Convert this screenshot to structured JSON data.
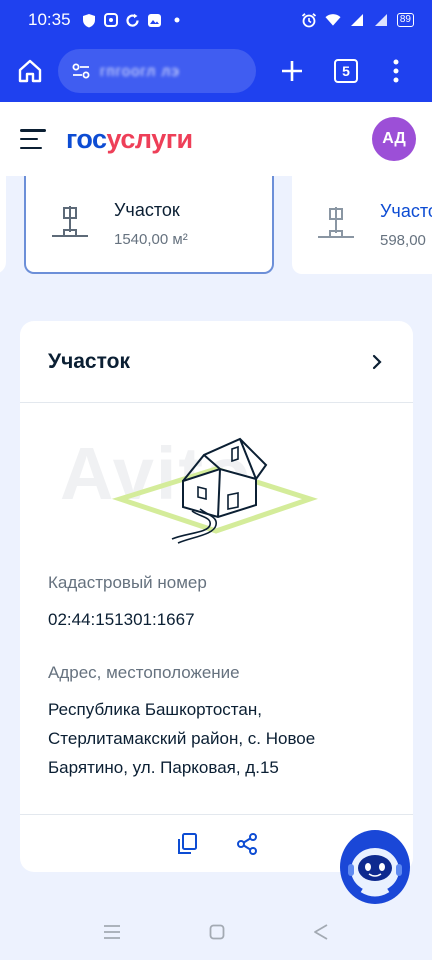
{
  "status_bar": {
    "time": "10:35",
    "battery": "89"
  },
  "browser": {
    "url_text": "гпгоогл лэ",
    "tab_count": "5"
  },
  "header": {
    "logo_gos": "гос",
    "logo_uslugi": "услуги",
    "avatar_initials": "АД"
  },
  "property_cards": [
    {
      "title": "Участок",
      "area": "1540,00 м²",
      "active": true
    },
    {
      "title": "Участо",
      "area": "598,00",
      "active": false
    }
  ],
  "detail": {
    "title": "Участок",
    "cadastral_label": "Кадастровый номер",
    "cadastral_value": "02:44:151301:1667",
    "address_label": "Адрес, местоположение",
    "address_line1": "Республика Башкортостан,",
    "address_line2": "Стерлитамакский район, с. Новое",
    "address_line3": "Барятино, ул. Парковая, д.15"
  },
  "watermark": "Avito",
  "colors": {
    "brand_blue": "#1f41ef",
    "gos_blue": "#0d4cd3",
    "uslugi_red": "#ee3f58",
    "avatar": "#9c4fd7"
  }
}
